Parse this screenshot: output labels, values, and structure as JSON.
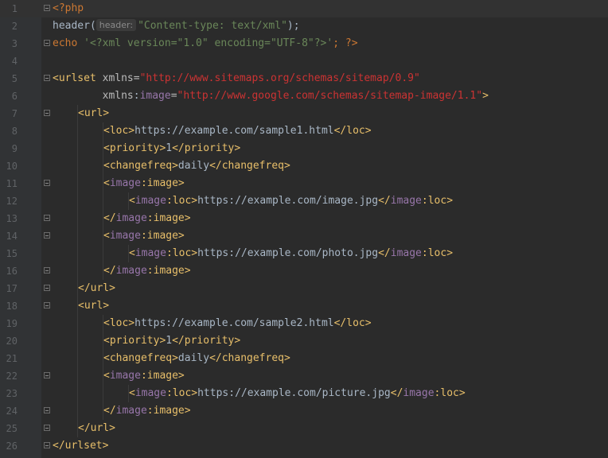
{
  "colors": {
    "background": "#2b2b2b",
    "gutter": "#313335",
    "line_number": "#606366",
    "xml_tag": "#e8bf6a",
    "namespace_prefix": "#9876aa",
    "url_value": "#cc3333",
    "php_keyword": "#cc7832",
    "php_string": "#6a8759",
    "function_name": "#ffc66d"
  },
  "editor": {
    "lines": [
      {
        "n": "1",
        "fold": true,
        "indent": 0,
        "tokens": [
          {
            "c": "t-php",
            "t": "<?php"
          }
        ]
      },
      {
        "n": "2",
        "fold": false,
        "indent": 0,
        "tokens": [
          {
            "c": "t-plain",
            "t": "header("
          },
          {
            "c": "t-hint",
            "t": "header:"
          },
          {
            "c": "t-str",
            "t": "\"Content-type: text/xml\""
          },
          {
            "c": "t-plain",
            "t": ");"
          }
        ]
      },
      {
        "n": "3",
        "fold": true,
        "indent": 0,
        "tokens": [
          {
            "c": "t-kw",
            "t": "echo "
          },
          {
            "c": "t-str",
            "t": "'<?xml version=\"1.0\" encoding=\"UTF-8\"?>'"
          },
          {
            "c": "t-kw",
            "t": "; ?>"
          }
        ]
      },
      {
        "n": "4",
        "fold": false,
        "indent": 0,
        "tokens": []
      },
      {
        "n": "5",
        "fold": true,
        "indent": 0,
        "tokens": [
          {
            "c": "t-tag",
            "t": "<urlset "
          },
          {
            "c": "t-attr",
            "t": "xmlns="
          },
          {
            "c": "t-val",
            "t": "\"http://www.sitemaps.org/schemas/sitemap/0.9\""
          }
        ]
      },
      {
        "n": "6",
        "fold": false,
        "indent": 0,
        "tokens": [
          {
            "c": "t-attr",
            "t": "        xmlns"
          },
          {
            "c": "t-plain",
            "t": ":"
          },
          {
            "c": "t-ns",
            "t": "image"
          },
          {
            "c": "t-attr",
            "t": "="
          },
          {
            "c": "t-val",
            "t": "\"http://www.google.com/schemas/sitemap-image/1.1\""
          },
          {
            "c": "t-tag",
            "t": ">"
          }
        ]
      },
      {
        "n": "7",
        "fold": true,
        "indent": 1,
        "tokens": [
          {
            "c": "t-tag",
            "t": "<url>"
          }
        ]
      },
      {
        "n": "8",
        "fold": false,
        "indent": 2,
        "tokens": [
          {
            "c": "t-tag",
            "t": "<loc>"
          },
          {
            "c": "t-plain",
            "t": "https://example.com/sample1.html"
          },
          {
            "c": "t-tag",
            "t": "</loc>"
          }
        ]
      },
      {
        "n": "9",
        "fold": false,
        "indent": 2,
        "tokens": [
          {
            "c": "t-tag",
            "t": "<priority>"
          },
          {
            "c": "t-plain",
            "t": "1"
          },
          {
            "c": "t-tag",
            "t": "</priority>"
          }
        ]
      },
      {
        "n": "10",
        "fold": false,
        "indent": 2,
        "tokens": [
          {
            "c": "t-tag",
            "t": "<changefreq>"
          },
          {
            "c": "t-plain",
            "t": "daily"
          },
          {
            "c": "t-tag",
            "t": "</changefreq>"
          }
        ]
      },
      {
        "n": "11",
        "fold": true,
        "indent": 2,
        "tokens": [
          {
            "c": "t-tag",
            "t": "<"
          },
          {
            "c": "t-ns",
            "t": "image"
          },
          {
            "c": "t-tag",
            "t": ":image>"
          }
        ]
      },
      {
        "n": "12",
        "fold": false,
        "indent": 3,
        "tokens": [
          {
            "c": "t-tag",
            "t": "<"
          },
          {
            "c": "t-ns",
            "t": "image"
          },
          {
            "c": "t-tag",
            "t": ":loc>"
          },
          {
            "c": "t-plain",
            "t": "https://example.com/image.jpg"
          },
          {
            "c": "t-tag",
            "t": "</"
          },
          {
            "c": "t-ns",
            "t": "image"
          },
          {
            "c": "t-tag",
            "t": ":loc>"
          }
        ]
      },
      {
        "n": "13",
        "fold": true,
        "indent": 2,
        "tokens": [
          {
            "c": "t-tag",
            "t": "</"
          },
          {
            "c": "t-ns",
            "t": "image"
          },
          {
            "c": "t-tag",
            "t": ":image>"
          }
        ]
      },
      {
        "n": "14",
        "fold": true,
        "indent": 2,
        "tokens": [
          {
            "c": "t-tag",
            "t": "<"
          },
          {
            "c": "t-ns",
            "t": "image"
          },
          {
            "c": "t-tag",
            "t": ":image>"
          }
        ]
      },
      {
        "n": "15",
        "fold": false,
        "indent": 3,
        "tokens": [
          {
            "c": "t-tag",
            "t": "<"
          },
          {
            "c": "t-ns",
            "t": "image"
          },
          {
            "c": "t-tag",
            "t": ":loc>"
          },
          {
            "c": "t-plain",
            "t": "https://example.com/photo.jpg"
          },
          {
            "c": "t-tag",
            "t": "</"
          },
          {
            "c": "t-ns",
            "t": "image"
          },
          {
            "c": "t-tag",
            "t": ":loc>"
          }
        ]
      },
      {
        "n": "16",
        "fold": true,
        "indent": 2,
        "tokens": [
          {
            "c": "t-tag",
            "t": "</"
          },
          {
            "c": "t-ns",
            "t": "image"
          },
          {
            "c": "t-tag",
            "t": ":image>"
          }
        ]
      },
      {
        "n": "17",
        "fold": true,
        "indent": 1,
        "tokens": [
          {
            "c": "t-tag",
            "t": "</url>"
          }
        ]
      },
      {
        "n": "18",
        "fold": true,
        "indent": 1,
        "tokens": [
          {
            "c": "t-tag",
            "t": "<url>"
          }
        ]
      },
      {
        "n": "19",
        "fold": false,
        "indent": 2,
        "tokens": [
          {
            "c": "t-tag",
            "t": "<loc>"
          },
          {
            "c": "t-plain",
            "t": "https://example.com/sample2.html"
          },
          {
            "c": "t-tag",
            "t": "</loc>"
          }
        ]
      },
      {
        "n": "20",
        "fold": false,
        "indent": 2,
        "tokens": [
          {
            "c": "t-tag",
            "t": "<priority>"
          },
          {
            "c": "t-plain",
            "t": "1"
          },
          {
            "c": "t-tag",
            "t": "</priority>"
          }
        ]
      },
      {
        "n": "21",
        "fold": false,
        "indent": 2,
        "tokens": [
          {
            "c": "t-tag",
            "t": "<changefreq>"
          },
          {
            "c": "t-plain",
            "t": "daily"
          },
          {
            "c": "t-tag",
            "t": "</changefreq>"
          }
        ]
      },
      {
        "n": "22",
        "fold": true,
        "indent": 2,
        "tokens": [
          {
            "c": "t-tag",
            "t": "<"
          },
          {
            "c": "t-ns",
            "t": "image"
          },
          {
            "c": "t-tag",
            "t": ":image>"
          }
        ]
      },
      {
        "n": "23",
        "fold": false,
        "indent": 3,
        "tokens": [
          {
            "c": "t-tag",
            "t": "<"
          },
          {
            "c": "t-ns",
            "t": "image"
          },
          {
            "c": "t-tag",
            "t": ":loc>"
          },
          {
            "c": "t-plain",
            "t": "https://example.com/picture.jpg"
          },
          {
            "c": "t-tag",
            "t": "</"
          },
          {
            "c": "t-ns",
            "t": "image"
          },
          {
            "c": "t-tag",
            "t": ":loc>"
          }
        ]
      },
      {
        "n": "24",
        "fold": true,
        "indent": 2,
        "tokens": [
          {
            "c": "t-tag",
            "t": "</"
          },
          {
            "c": "t-ns",
            "t": "image"
          },
          {
            "c": "t-tag",
            "t": ":image>"
          }
        ]
      },
      {
        "n": "25",
        "fold": true,
        "indent": 1,
        "tokens": [
          {
            "c": "t-tag",
            "t": "</url>"
          }
        ]
      },
      {
        "n": "26",
        "fold": true,
        "indent": 0,
        "tokens": [
          {
            "c": "t-tag",
            "t": "</urlset>"
          }
        ]
      }
    ]
  }
}
